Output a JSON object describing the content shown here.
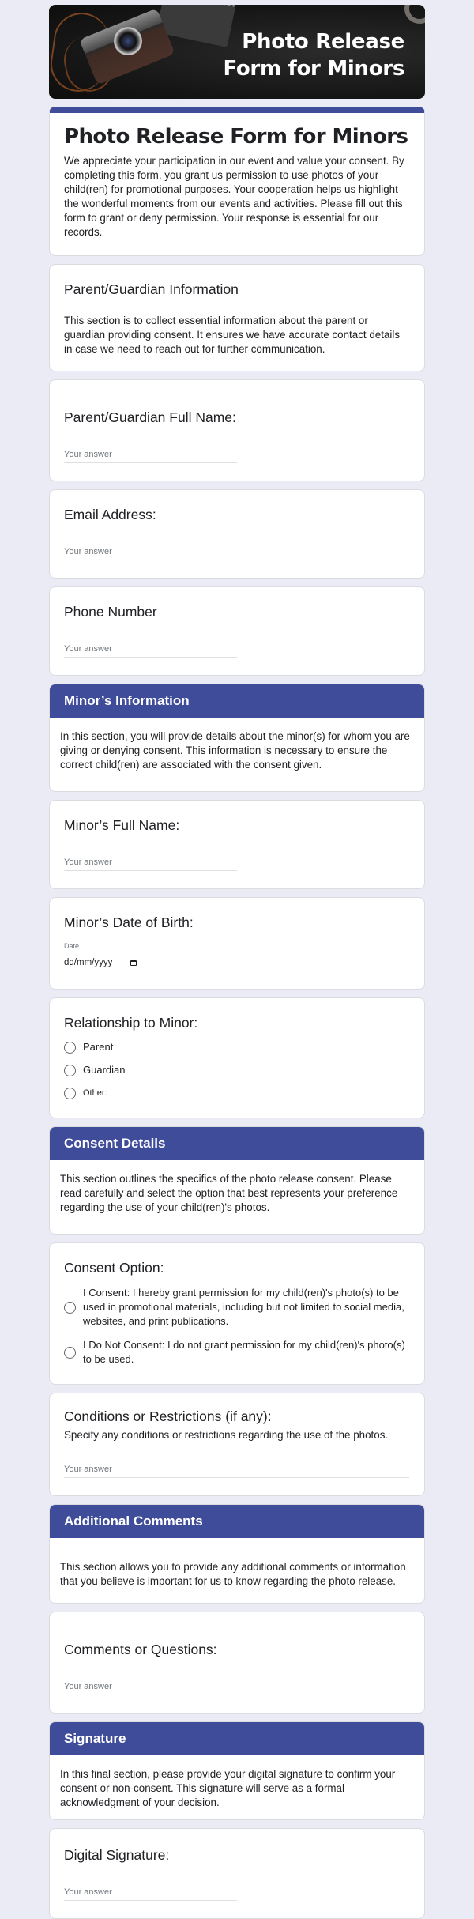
{
  "banner": {
    "title_line1": "Photo Release",
    "title_line2": "Form for Minors"
  },
  "header": {
    "title": "Photo Release Form for Minors",
    "description": "We appreciate your participation in our event and value your consent. By completing this form, you grant us permission to use photos of your child(ren) for promotional purposes. Your cooperation helps us highlight the wonderful moments from our events and activities. Please fill out this form to grant or deny permission. Your response is essential for our records."
  },
  "parent_section": {
    "title": "Parent/Guardian Information",
    "description": "This section is to collect essential information about the parent or guardian providing consent. It ensures we have accurate contact details in case we need to reach out for further communication."
  },
  "questions": {
    "parent_name": {
      "label": "Parent/Guardian Full Name:",
      "placeholder": "Your answer",
      "value": ""
    },
    "email": {
      "label": "Email Address:",
      "placeholder": "Your answer",
      "value": ""
    },
    "phone": {
      "label": "Phone Number",
      "placeholder": "Your answer",
      "value": ""
    },
    "minor_name": {
      "label": "Minor’s Full Name:",
      "placeholder": "Your answer",
      "value": ""
    },
    "minor_dob": {
      "label": "Minor’s Date of Birth:",
      "date_label": "Date",
      "date_placeholder": "dd/mm/yyyy"
    },
    "relationship": {
      "label": "Relationship to Minor:",
      "options": [
        "Parent",
        "Guardian"
      ],
      "other_label": "Other:"
    },
    "consent_option": {
      "label": "Consent Option:",
      "options": [
        "I Consent: I hereby grant permission for my child(ren)'s photo(s) to be used in promotional materials, including but not limited to social media, websites, and print publications.",
        "I Do Not Consent: I do not grant permission for my child(ren)'s photo(s) to be used."
      ]
    },
    "conditions": {
      "label": "Conditions or Restrictions (if any):",
      "description": "Specify any conditions or restrictions regarding the use of the photos.",
      "placeholder": "Your answer"
    },
    "comments": {
      "label": "Comments or Questions:",
      "placeholder": "Your answer"
    },
    "signature": {
      "label": "Digital Signature:",
      "placeholder": "Your answer"
    }
  },
  "sections": {
    "minor": {
      "title": "Minor’s Information",
      "description": "In this section, you will provide details about the minor(s) for whom you are giving or denying consent. This information is necessary to ensure the correct child(ren) are associated with the consent given."
    },
    "consent": {
      "title": "Consent Details",
      "description": "This section outlines the specifics of the photo release consent. Please read carefully and select the option that best represents your preference regarding the use of your child(ren)'s photos."
    },
    "additional": {
      "title": "Additional Comments",
      "description": "This section allows you to provide any additional comments or information that you believe is important for us to know regarding the photo release."
    },
    "signature": {
      "title": "Signature",
      "description": "In this final section, please provide your digital signature to confirm your consent or non-consent. This signature will serve as a formal acknowledgment of your decision."
    }
  },
  "colors": {
    "accent": "#3f4c9a",
    "background": "#ebebf5",
    "text": "#202124",
    "placeholder": "#70757a"
  }
}
